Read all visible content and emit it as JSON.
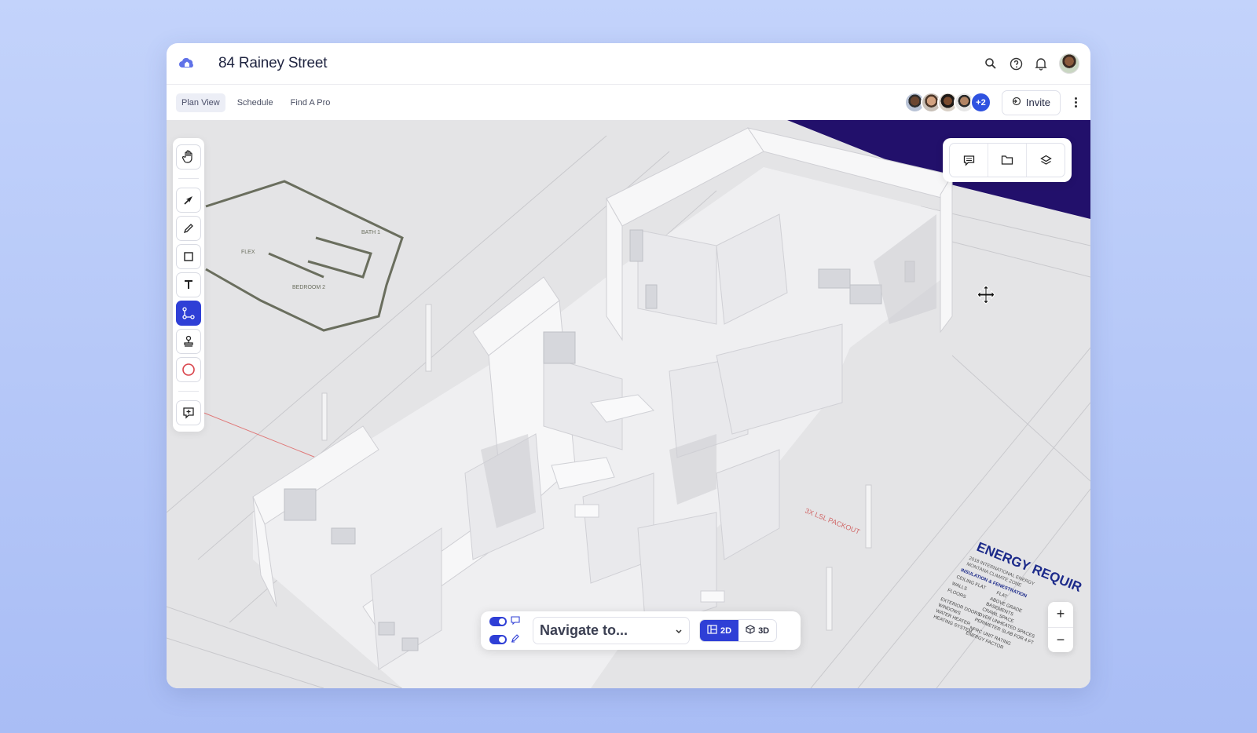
{
  "app": {
    "title": "84 Rainey Street",
    "logo_icon": "home-cloud-icon",
    "brand_color": "#2f3fd6"
  },
  "topbar": {
    "icons": [
      "search-icon",
      "help-icon",
      "bell-icon",
      "user-avatar"
    ]
  },
  "tabs": [
    {
      "label": "Plan View",
      "active": true
    },
    {
      "label": "Schedule",
      "active": false
    },
    {
      "label": "Find A Pro",
      "active": false
    }
  ],
  "collaborators": {
    "extra_count": "+2"
  },
  "invite": {
    "label": "Invite"
  },
  "toolbar": {
    "tools": [
      "hand-icon",
      "pointer-icon",
      "pencil-icon",
      "rectangle-icon",
      "text-icon",
      "path-icon",
      "stamp-icon",
      "circle-icon",
      "add-comment-icon"
    ],
    "active_tool": "path-icon"
  },
  "panel": {
    "buttons": [
      "comments-icon",
      "folder-icon",
      "layers-icon"
    ]
  },
  "bottom_bar": {
    "navigate_placeholder": "Navigate to...",
    "view_2d": "2D",
    "view_3d": "3D",
    "active_view": "2D"
  },
  "blueprint_text": {
    "energy_heading": "ENERGY REQUIR",
    "energy_lines": [
      "2018 INTERNATIONAL ENERGY",
      "MONTANA CLIMATE ZONE",
      "INSULATION & FENESTRATION",
      "CEILING FLAT",
      "WALLS",
      "FLOORS",
      "EXTERIOR DOORS",
      "WINDOWS",
      "WATER HEATER",
      "HEATING SYSTEM"
    ],
    "energy_values": [
      "FLAT",
      "ABOVE GRADE",
      "BASEMENTS",
      "CRAWL SPACE",
      "OVER UNHEATED SPACES",
      "PERIMETER SLAB FOR 4 FT",
      "NFRC UNIT RATING",
      "ENERGY FACTOR"
    ],
    "packout_label": "3X LSL PACKOUT",
    "room_labels": [
      "FLEX",
      "BATH 1",
      "BEDROOM 2"
    ]
  }
}
